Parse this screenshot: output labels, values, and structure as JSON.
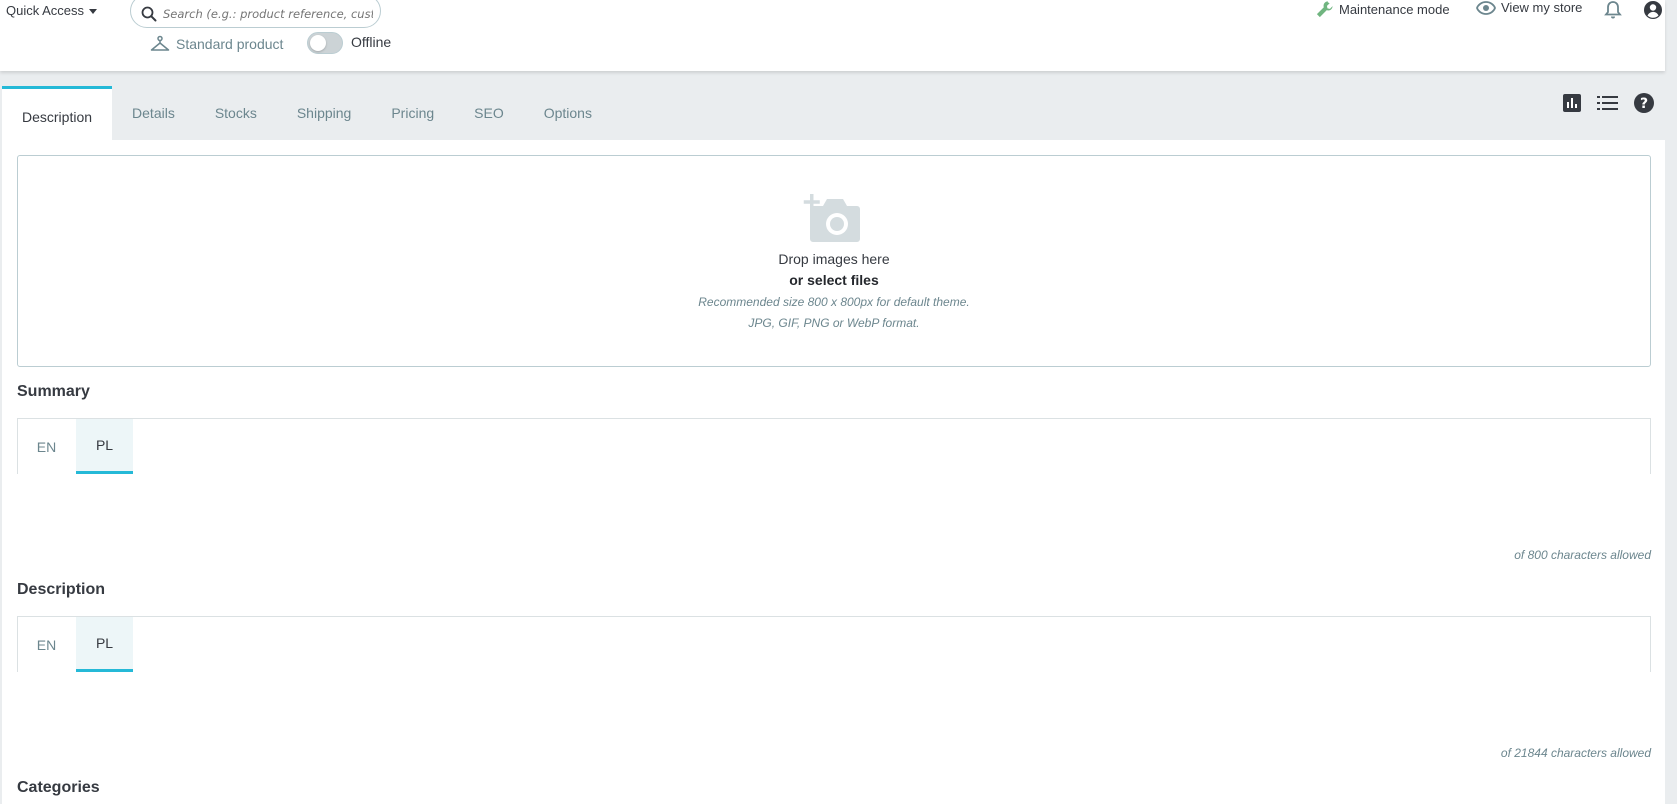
{
  "header": {
    "quick_access": "Quick Access",
    "search_placeholder": "Search (e.g.: product reference, custon",
    "maintenance_mode": "Maintenance mode",
    "view_my_store": "View my store",
    "product_type": "Standard product",
    "status_label": "Offline"
  },
  "tabs": [
    "Description",
    "Details",
    "Stocks",
    "Shipping",
    "Pricing",
    "SEO",
    "Options"
  ],
  "dropzone": {
    "line1": "Drop images here",
    "line2": "or select files",
    "line3": "Recommended size 800 x 800px for default theme.",
    "line4": "JPG, GIF, PNG or WebP format."
  },
  "summary": {
    "title": "Summary",
    "langs": [
      "EN",
      "PL"
    ],
    "counter": "of 800 characters allowed"
  },
  "description": {
    "title": "Description",
    "langs": [
      "EN",
      "PL"
    ],
    "counter": "of 21844 characters allowed"
  },
  "categories": {
    "title": "Categories"
  },
  "colors": {
    "accent": "#25b9d7",
    "text": "#363a41",
    "muted": "#6c868e",
    "green": "#70b580"
  }
}
